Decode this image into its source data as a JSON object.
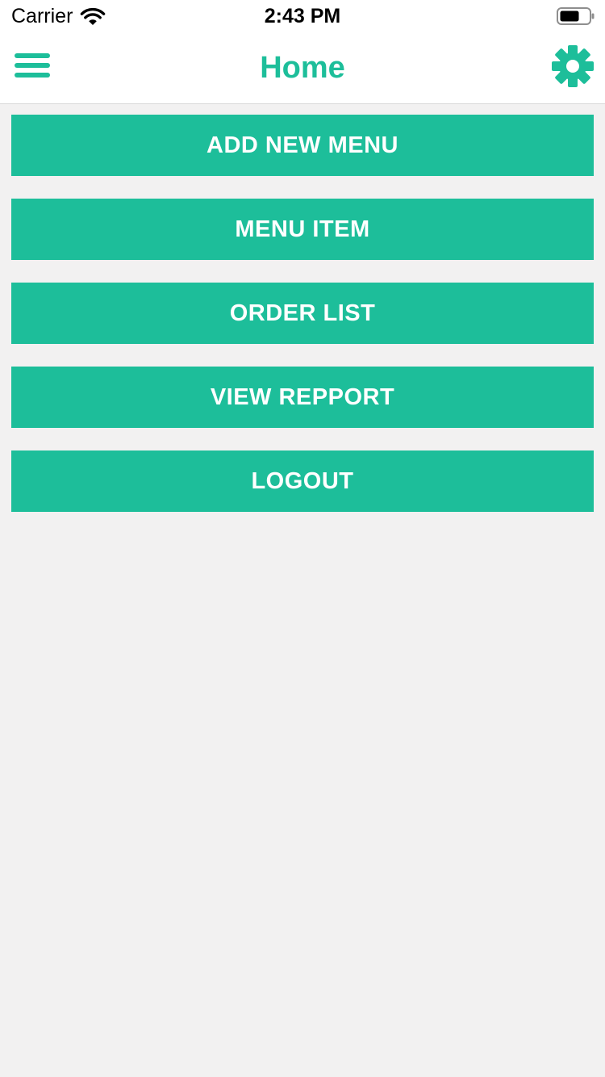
{
  "status_bar": {
    "carrier": "Carrier",
    "time": "2:43 PM",
    "wifi_icon": "wifi-icon",
    "battery_icon": "battery-icon"
  },
  "nav_bar": {
    "title": "Home",
    "left_icon": "hamburger-menu-icon",
    "right_icon": "gear-icon"
  },
  "menu_buttons": [
    {
      "label": "ADD NEW MENU"
    },
    {
      "label": "MENU ITEM"
    },
    {
      "label": "ORDER LIST"
    },
    {
      "label": "VIEW REPPORT"
    },
    {
      "label": "LOGOUT"
    }
  ],
  "colors": {
    "accent": "#1dbe9a",
    "background": "#f2f1f1",
    "bar_background": "#ffffff",
    "button_text": "#ffffff"
  }
}
